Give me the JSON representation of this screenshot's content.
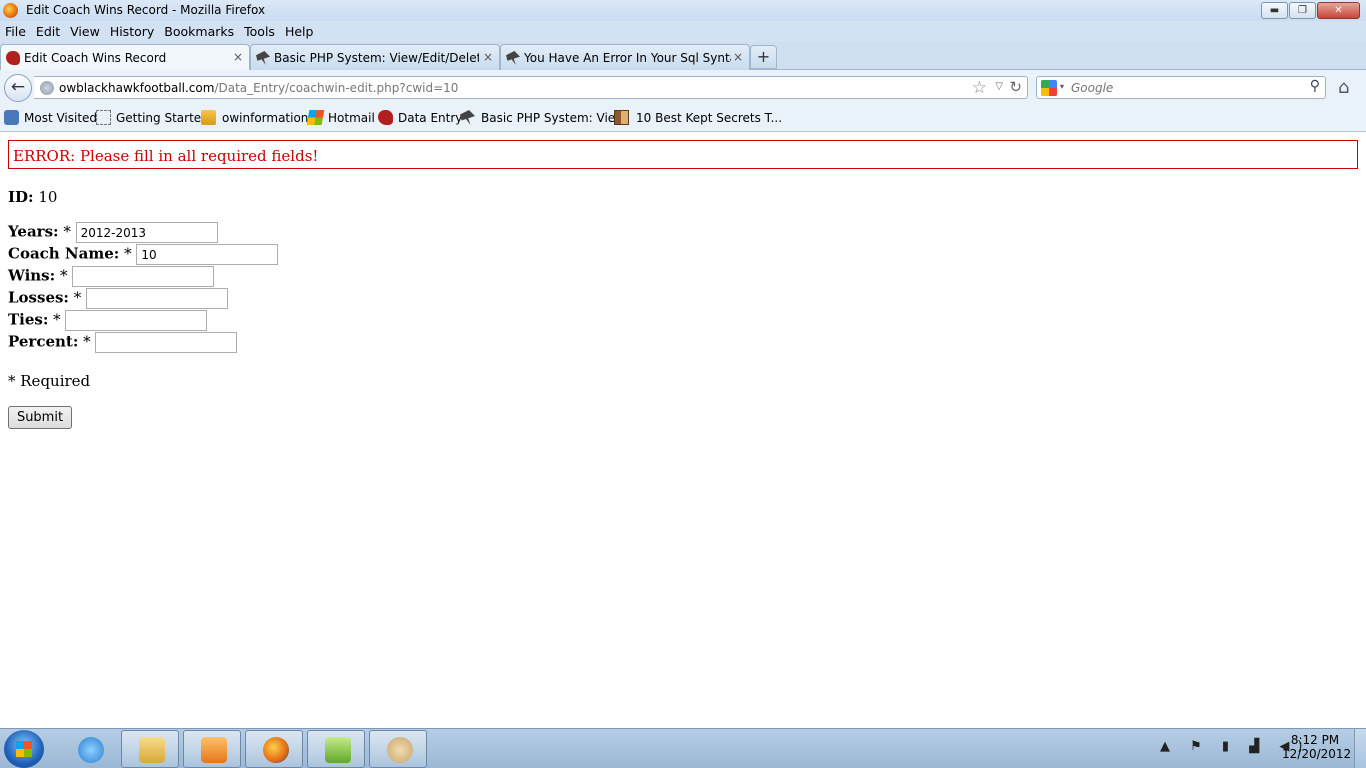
{
  "window": {
    "title": "Edit Coach Wins Record - Mozilla Firefox",
    "controls": {
      "minimize": "▬",
      "maximize": "❐",
      "close": "✕"
    }
  },
  "menu": [
    "File",
    "Edit",
    "View",
    "History",
    "Bookmarks",
    "Tools",
    "Help"
  ],
  "tabs": [
    {
      "label": "Edit Coach Wins Record",
      "icon": "hawk-icon",
      "active": true
    },
    {
      "label": "Basic PHP System: View/Edit/Delete/...",
      "icon": "bird-icon",
      "active": false
    },
    {
      "label": "You Have An Error In Your Sql Syntax ...",
      "icon": "bird-icon",
      "active": false
    }
  ],
  "tab_close": "×",
  "new_tab": "+",
  "nav": {
    "back": "←",
    "url_host": "owblackhawkfootball.com",
    "url_path": "/Data_Entry/coachwin-edit.php?cwid=10",
    "bookmark_star": "☆",
    "url_dropdown": "▽",
    "reload": "↻",
    "search_placeholder": "Google",
    "search_engine_arrow": "▾",
    "search_icon": "⚲",
    "home": "⌂"
  },
  "bookmarks": [
    {
      "label": "Most Visited",
      "icon": "most-visited-icon"
    },
    {
      "label": "Getting Started",
      "icon": "dotted-page-icon"
    },
    {
      "label": "owinformation",
      "icon": "pma-icon"
    },
    {
      "label": "Hotmail",
      "icon": "windows-flag-icon"
    },
    {
      "label": "Data Entry",
      "icon": "hawk-icon"
    },
    {
      "label": "Basic PHP System: Vie...",
      "icon": "bird-icon"
    },
    {
      "label": "10 Best Kept Secrets T...",
      "icon": "door-icon"
    }
  ],
  "page": {
    "error": "ERROR: Please fill in all required fields!",
    "id_label": "ID:",
    "id_value": "10",
    "required_mark": "*",
    "fields": [
      {
        "label": "Years:",
        "value": "2012-2013"
      },
      {
        "label": "Coach Name:",
        "value": "10"
      },
      {
        "label": "Wins:",
        "value": ""
      },
      {
        "label": "Losses:",
        "value": ""
      },
      {
        "label": "Ties:",
        "value": ""
      },
      {
        "label": "Percent:",
        "value": ""
      }
    ],
    "required_note": "* Required",
    "submit": "Submit"
  },
  "taskbar": {
    "apps": [
      {
        "name": "internet-explorer-icon",
        "open": false,
        "color": "#2a7fd4"
      },
      {
        "name": "file-explorer-icon",
        "open": true,
        "color": "#e8c35a"
      },
      {
        "name": "media-player-icon",
        "open": true,
        "color": "#f08a1c"
      },
      {
        "name": "firefox-icon",
        "open": true,
        "color": "#e46b12"
      },
      {
        "name": "notepad-plus-icon",
        "open": true,
        "color": "#7bbf3a"
      },
      {
        "name": "paint-icon",
        "open": true,
        "color": "#c9a36a"
      }
    ],
    "tray": "▲ ⚑ ▮ ▟ ◀)",
    "time": "8:12 PM",
    "date": "12/20/2012"
  }
}
